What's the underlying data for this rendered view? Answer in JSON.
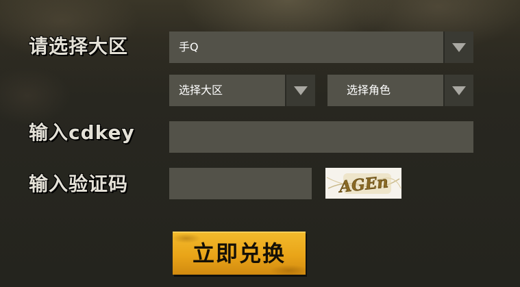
{
  "form": {
    "server_label": "请选择大区",
    "cdkey_label": "输入cdkey",
    "captcha_label": "输入验证码",
    "platform_select": {
      "selected": "手Q"
    },
    "server_select": {
      "selected": "选择大区"
    },
    "role_select": {
      "selected": "选择角色"
    },
    "cdkey_input": {
      "value": "",
      "placeholder": ""
    },
    "captcha_input": {
      "value": "",
      "placeholder": ""
    },
    "captcha_image": {
      "text": "AGEn"
    },
    "redeem_button": "立即兑换"
  },
  "colors": {
    "background": "#26251f",
    "field": "#535249",
    "arrow_box": "#3a3a33",
    "button": "#eaa71b",
    "label_text": "#e4e1d7"
  },
  "icons": {
    "dropdown": "chevron-down-icon"
  }
}
